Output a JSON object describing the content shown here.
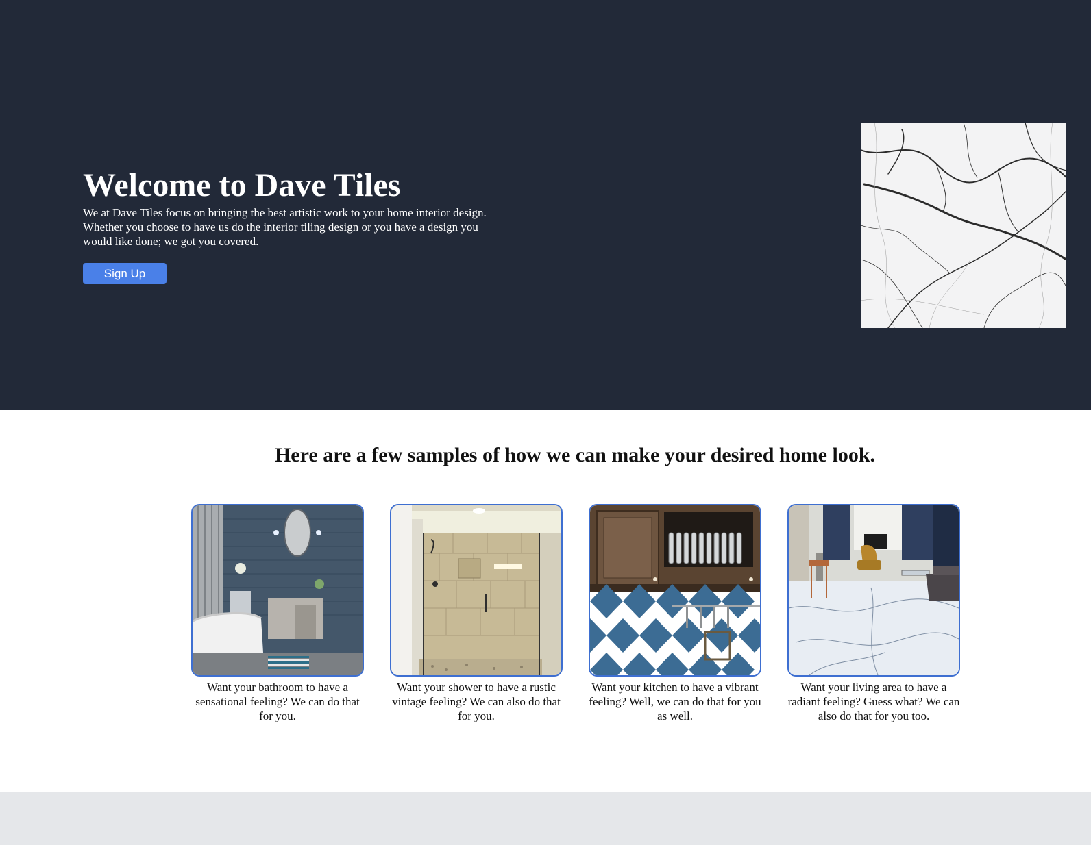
{
  "hero": {
    "title": "Welcome to Dave Tiles",
    "description": "We at Dave Tiles focus on bringing the best artistic work to your home interior design. Whether you choose to have us do the interior tiling design or you have a design you would like done; we got you covered.",
    "signup_label": "Sign Up",
    "image_icon": "marble-tile-image"
  },
  "samples": {
    "heading": "Here are a few samples of how we can make your desired home look.",
    "cards": [
      {
        "image_icon": "bathroom-image",
        "caption": "Want your bathroom to have a sensational feeling? We can do that for you."
      },
      {
        "image_icon": "shower-image",
        "caption": "Want your shower to have a rustic vintage feeling? We can also do that for you."
      },
      {
        "image_icon": "kitchen-image",
        "caption": "Want your kitchen to have a vibrant feeling? Well, we can do that for you as well."
      },
      {
        "image_icon": "living-area-image",
        "caption": "Want your living area to have a radiant feeling? Guess what? We can also do that for you too."
      }
    ]
  },
  "colors": {
    "hero_background": "#222938",
    "button": "#4a80e8",
    "card_border": "#3e6fd1",
    "footer_band": "#e5e7ea"
  }
}
